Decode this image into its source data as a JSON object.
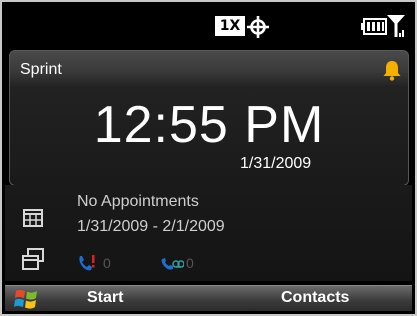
{
  "status_bar": {
    "network_label": "1X",
    "icons": [
      "roaming-icon",
      "battery-icon",
      "signal-icon"
    ]
  },
  "today": {
    "carrier": "Sprint",
    "time": "12:55 PM",
    "date": "1/31/2009",
    "alert_icon": "bell-icon"
  },
  "appointments": {
    "title": "No Appointments",
    "range": "1/31/2009 - 2/1/2009"
  },
  "notifications": {
    "missed_calls": "0",
    "voicemails": "0"
  },
  "softkeys": {
    "left": "Start",
    "right": "Contacts"
  },
  "colors": {
    "background": "#000000",
    "bell": "#f5b000",
    "missed_call": "#1e6ecf",
    "start_logo": [
      "#e8492b",
      "#7cba2a",
      "#1b9ad6",
      "#f6c21a"
    ]
  }
}
